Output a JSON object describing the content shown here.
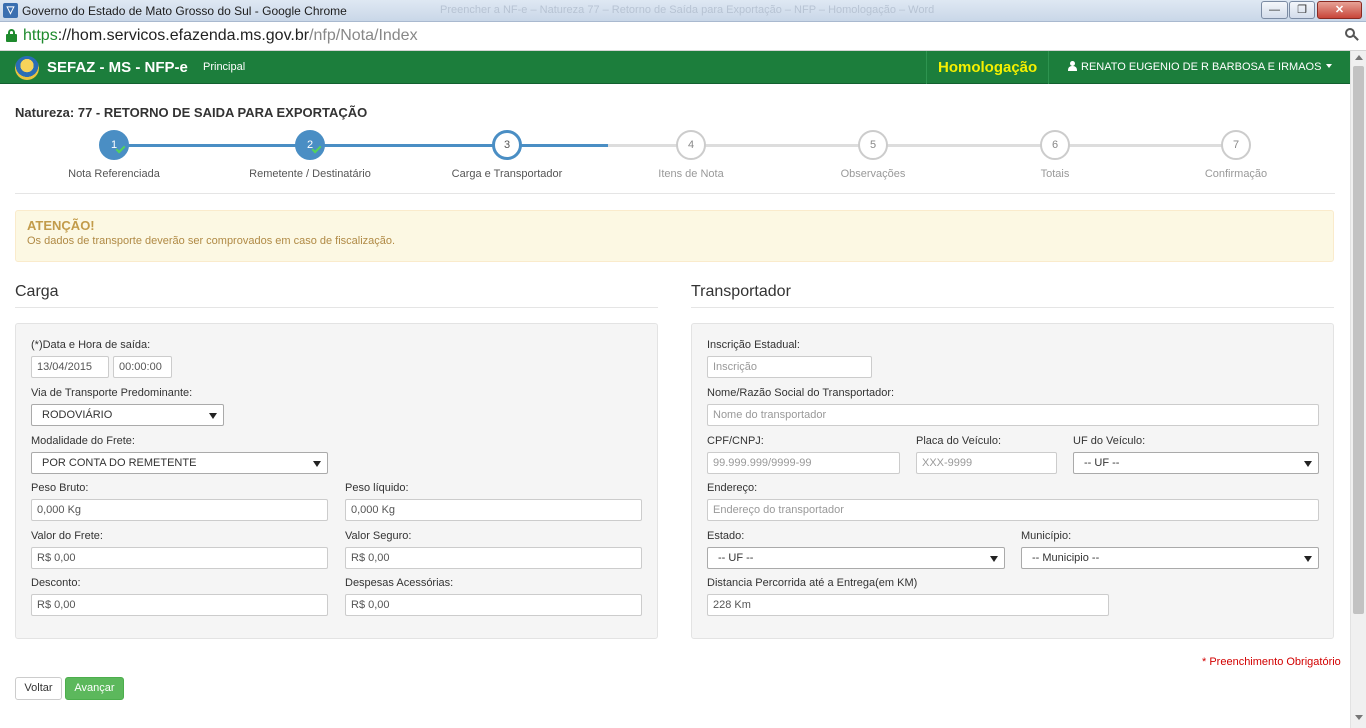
{
  "window": {
    "title": "Governo do Estado de Mato Grosso do Sul - Google Chrome",
    "ghost_tabs": "Preencher a NF-e – Natureza 77 – Retorno de Saída para Exportação – NFP – Homologação – Word",
    "app_icon": "chrome-app-icon",
    "controls": {
      "minimize": "—",
      "maximize": "❐",
      "close": "✕"
    }
  },
  "address_bar": {
    "scheme": "https",
    "host": "hom.servicos.efazenda.ms.gov.br",
    "path": "/nfp/Nota/Index"
  },
  "navbar": {
    "brand": "SEFAZ - MS - NFP-e",
    "menu_principal": "Principal",
    "environment": "Homologação",
    "user": "RENATO EUGENIO DE R BARBOSA E IRMAOS",
    "colors": {
      "bar": "#1c7e3c",
      "environment": "#f5f000"
    }
  },
  "page": {
    "natureza": "Natureza: 77 - RETORNO DE SAIDA PARA EXPORTAÇÃO"
  },
  "wizard": {
    "accent": "#4a8ec4",
    "steps": [
      {
        "number": "1",
        "label": "Nota Referenciada",
        "state": "done"
      },
      {
        "number": "2",
        "label": "Remetente / Destinatário",
        "state": "done"
      },
      {
        "number": "3",
        "label": "Carga e Transportador",
        "state": "active"
      },
      {
        "number": "4",
        "label": "Itens de Nota",
        "state": "todo"
      },
      {
        "number": "5",
        "label": "Observações",
        "state": "todo"
      },
      {
        "number": "6",
        "label": "Totais",
        "state": "todo"
      },
      {
        "number": "7",
        "label": "Confirmação",
        "state": "todo"
      }
    ]
  },
  "alert": {
    "title": "ATENÇÃO!",
    "text": "Os dados de transporte deverão ser comprovados em caso de fiscalização."
  },
  "carga": {
    "title": "Carga",
    "data_hora_label": "(*)Data e Hora de saída:",
    "data_value": "13/04/2015",
    "hora_value": "00:00:00",
    "via_label": "Via de Transporte Predominante:",
    "via_value": "RODOVIÁRIO",
    "modalidade_label": "Modalidade do Frete:",
    "modalidade_value": "POR CONTA DO REMETENTE",
    "peso_bruto_label": "Peso Bruto:",
    "peso_bruto_value": "0,000 Kg",
    "peso_liquido_label": "Peso líquido:",
    "peso_liquido_value": "0,000 Kg",
    "valor_frete_label": "Valor do Frete:",
    "valor_frete_value": "R$ 0,00",
    "valor_seguro_label": "Valor Seguro:",
    "valor_seguro_value": "R$ 0,00",
    "desconto_label": "Desconto:",
    "desconto_value": "R$ 0,00",
    "despesas_label": "Despesas Acessórias:",
    "despesas_value": "R$ 0,00"
  },
  "transportador": {
    "title": "Transportador",
    "ie_label": "Inscrição Estadual:",
    "ie_placeholder": "Inscrição",
    "nome_label": "Nome/Razão Social do Transportador:",
    "nome_placeholder": "Nome do transportador",
    "cpf_label": "CPF/CNPJ:",
    "cpf_placeholder": "99.999.999/9999-99",
    "placa_label": "Placa do Veículo:",
    "placa_placeholder": "XXX-9999",
    "uf_veiculo_label": "UF do Veículo:",
    "uf_veiculo_value": "-- UF --",
    "endereco_label": "Endereço:",
    "endereco_placeholder": "Endereço do transportador",
    "estado_label": "Estado:",
    "estado_value": "-- UF --",
    "municipio_label": "Município:",
    "municipio_value": "-- Municipio --",
    "distancia_label": "Distancia Percorrida até a Entrega(em KM)",
    "distancia_value": "228 Km"
  },
  "footer": {
    "required_note": "* Preenchimento Obrigatório",
    "voltar": "Voltar",
    "avancar": "Avançar",
    "avancar_color": "#5cb85c"
  }
}
